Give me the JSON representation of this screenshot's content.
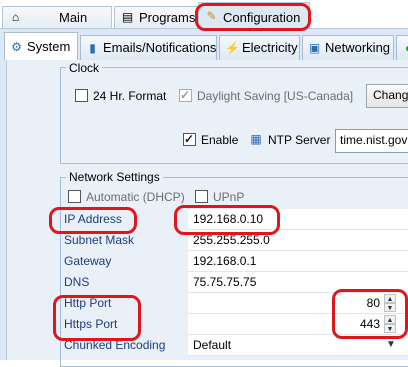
{
  "top_tabs": [
    {
      "label": "Main",
      "icon": "home-icon"
    },
    {
      "label": "Programs",
      "icon": "document-icon"
    },
    {
      "label": "Configuration",
      "icon": "wrench-icon"
    }
  ],
  "sub_tabs": [
    {
      "label": "System",
      "icon": "gear-icon"
    },
    {
      "label": "Emails/Notifications",
      "icon": "email-icon"
    },
    {
      "label": "Electricity",
      "icon": "lightning-icon"
    },
    {
      "label": "Networking",
      "icon": "network-icon"
    }
  ],
  "clock": {
    "legend": "Clock",
    "hr24_label": "24 Hr. Format",
    "dst_label": "Daylight Saving [US-Canada]",
    "change_button": "Change",
    "enable_label": "Enable",
    "ntp_label": "NTP Server",
    "ntp_value": "time.nist.gov"
  },
  "network": {
    "legend": "Network Settings",
    "dhcp_label": "Automatic (DHCP)",
    "upnp_label": "UPnP",
    "rows": [
      {
        "label": "IP Address",
        "value": "192.168.0.10"
      },
      {
        "label": "Subnet Mask",
        "value": "255.255.255.0"
      },
      {
        "label": "Gateway",
        "value": "192.168.0.1"
      },
      {
        "label": "DNS",
        "value": "75.75.75.75"
      },
      {
        "label": "Http Port",
        "value": "80"
      },
      {
        "label": "Https Port",
        "value": "443"
      },
      {
        "label": "Chunked Encoding",
        "value": "Default"
      }
    ]
  },
  "colors": {
    "annotation": "#e0161d",
    "label_blue": "#1e3c80",
    "tab_bg": "#dce8f5"
  }
}
